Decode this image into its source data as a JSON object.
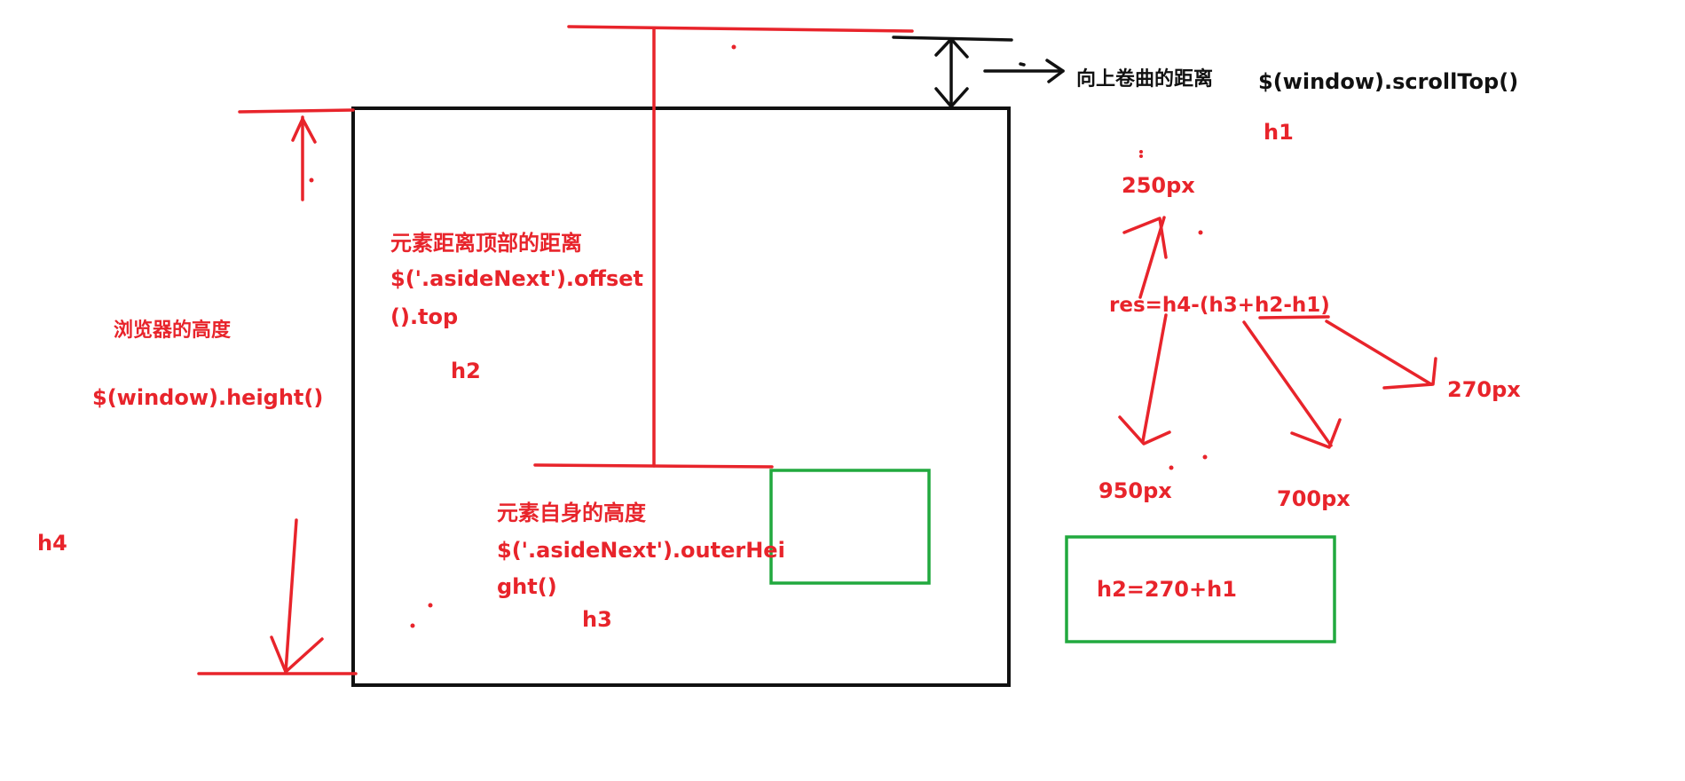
{
  "colors": {
    "red": "#e8242b",
    "black": "#111111",
    "green": "#21a93e"
  },
  "labels": {
    "scroll_label": "向上卷曲的距离",
    "scroll_code": "$(window).scrollTop()",
    "h1": "h1",
    "offset_title": "元素距离顶部的距离",
    "offset_code_1": "$('.asideNext').offset",
    "offset_code_2": "().top",
    "h2": "h2",
    "browser_title": "浏览器的高度",
    "browser_code": "$(window).height()",
    "h4": "h4",
    "self_title": "元素自身的高度",
    "self_code_1": "$('.asideNext').outerHei",
    "self_code_2": "ght()",
    "h3": "h3",
    "px250": "250px",
    "formula": "res=h4-(h3+h2-h1)",
    "px950": "950px",
    "px700": "700px",
    "px270": "270px",
    "box_formula": "h2=270+h1"
  }
}
